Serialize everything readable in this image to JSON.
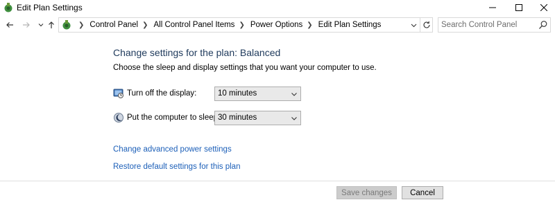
{
  "window": {
    "title": "Edit Plan Settings"
  },
  "nav": {
    "breadcrumbs": [
      "Control Panel",
      "All Control Panel Items",
      "Power Options",
      "Edit Plan Settings"
    ]
  },
  "search": {
    "placeholder": "Search Control Panel"
  },
  "main": {
    "heading": "Change settings for the plan: Balanced",
    "description": "Choose the sleep and display settings that you want your computer to use.",
    "settings": [
      {
        "label": "Turn off the display:",
        "value": "10 minutes"
      },
      {
        "label": "Put the computer to sleep:",
        "value": "30 minutes"
      }
    ],
    "links": {
      "advanced": "Change advanced power settings",
      "restore": "Restore default settings for this plan"
    }
  },
  "footer": {
    "save_label": "Save changes",
    "cancel_label": "Cancel",
    "save_enabled": false
  },
  "colors": {
    "heading": "#1e395b",
    "link": "#1c5fb8",
    "disabled_button": "#cccccc"
  }
}
